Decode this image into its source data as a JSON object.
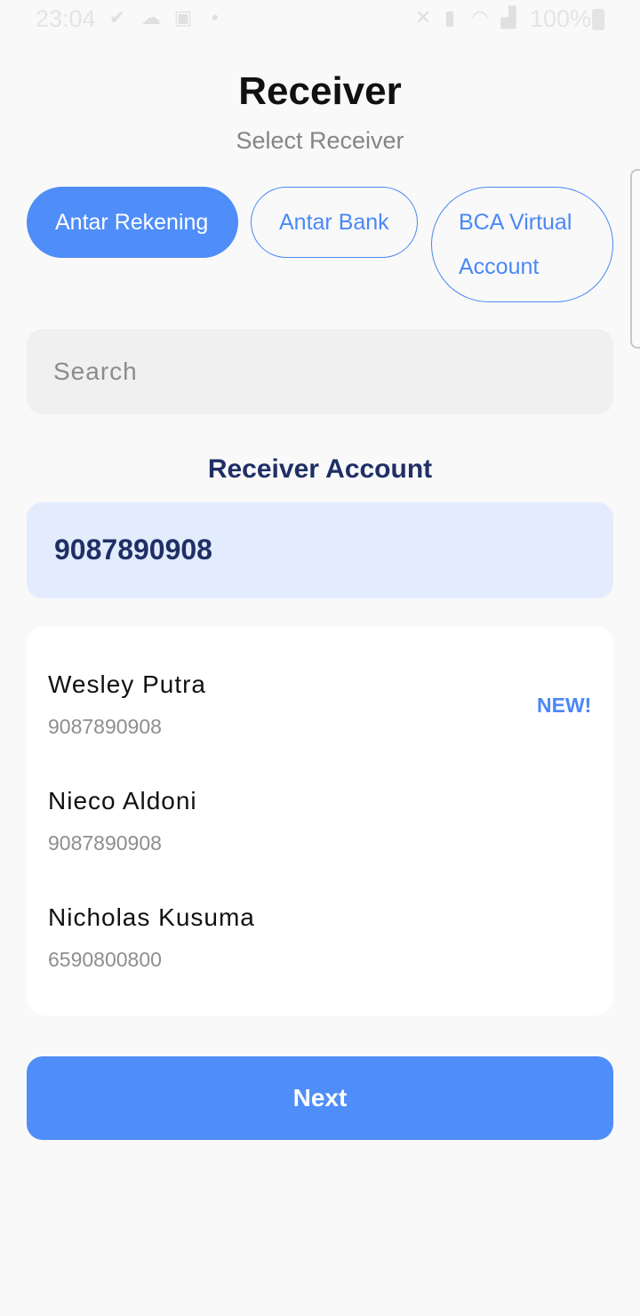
{
  "status_bar": {
    "time": "23:04",
    "battery_text": "100%",
    "icons": [
      "check-circle-icon",
      "cloud-icon",
      "gallery-icon",
      "dot-icon",
      "mute-icon",
      "battery-saver-icon",
      "wifi-icon",
      "signal-icon",
      "battery-icon"
    ]
  },
  "header": {
    "title": "Receiver",
    "subtitle": "Select Receiver"
  },
  "tabs": [
    {
      "label": "Antar Rekening",
      "active": true
    },
    {
      "label": "Antar Bank",
      "active": false
    },
    {
      "label": "BCA Virtual Account",
      "active": false
    }
  ],
  "search": {
    "placeholder": "Search",
    "value": ""
  },
  "receiver_account": {
    "title": "Receiver Account",
    "number": "9087890908"
  },
  "receivers": [
    {
      "name": "Wesley Putra",
      "account": "9087890908",
      "badge": "NEW!"
    },
    {
      "name": "Nieco Aldoni",
      "account": "9087890908"
    },
    {
      "name": "Nicholas Kusuma",
      "account": "6590800800"
    }
  ],
  "actions": {
    "next_label": "Next"
  },
  "colors": {
    "accent": "#4f8df8",
    "dark_text": "#1f2f66",
    "account_bg": "#e3ecfd"
  }
}
